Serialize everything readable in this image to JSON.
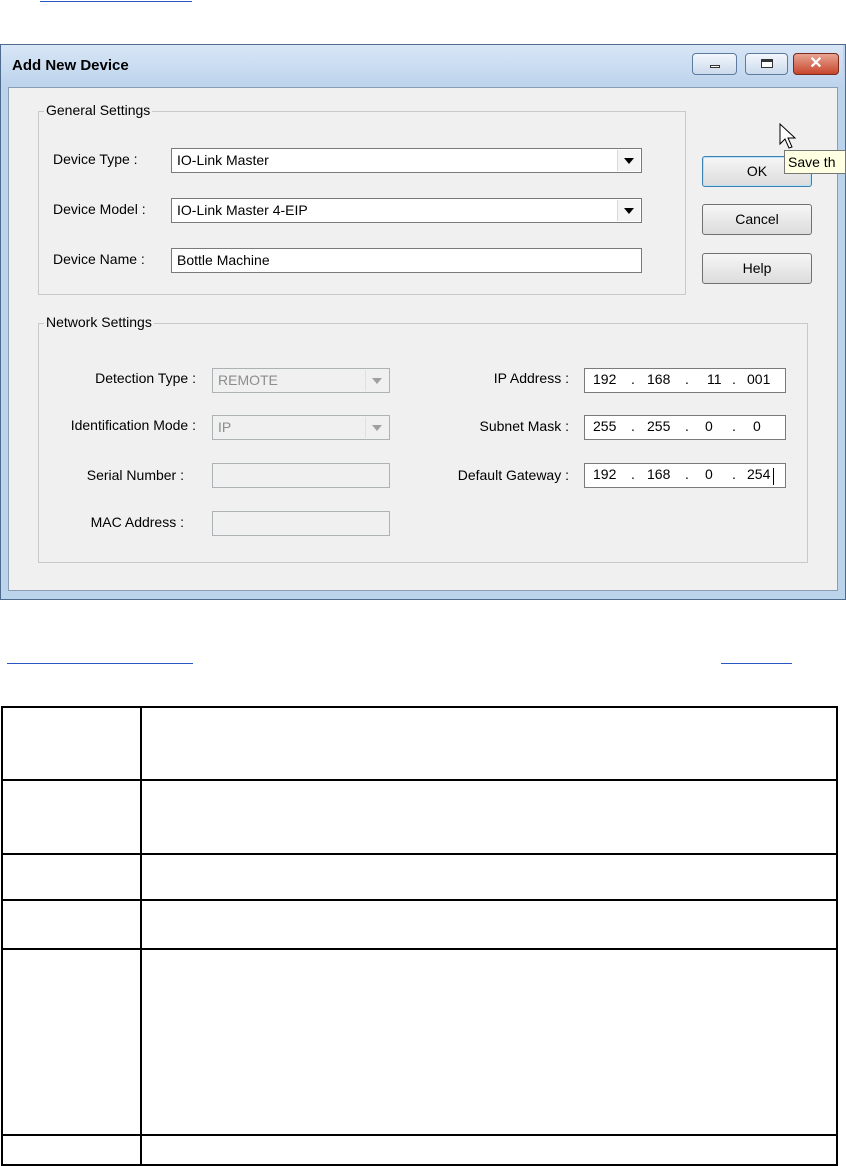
{
  "window": {
    "title": "Add New Device",
    "title_buttons": {
      "minimize": "minimize-icon",
      "maximize": "maximize-icon",
      "close": "close-icon"
    }
  },
  "general_settings": {
    "legend": "General Settings",
    "device_type_label": "Device Type :",
    "device_type_value": "IO-Link Master",
    "device_model_label": "Device Model :",
    "device_model_value": "IO-Link Master 4-EIP",
    "device_name_label": "Device Name :",
    "device_name_value": "Bottle Machine"
  },
  "network_settings": {
    "legend": "Network Settings",
    "detection_type_label": "Detection Type :",
    "detection_type_value": "REMOTE",
    "identification_mode_label": "Identification Mode :",
    "identification_mode_value": "IP",
    "serial_number_label": "Serial Number :",
    "serial_number_value": "",
    "mac_address_label": "MAC Address :",
    "mac_address_value": "",
    "ip_address_label": "IP Address :",
    "ip_address": [
      "192",
      "168",
      "11",
      "001"
    ],
    "subnet_mask_label": "Subnet Mask :",
    "subnet_mask": [
      "255",
      "255",
      "0",
      "0"
    ],
    "default_gateway_label": "Default Gateway :",
    "default_gateway": [
      "192",
      "168",
      "0",
      "254"
    ]
  },
  "buttons": {
    "ok": "OK",
    "cancel": "Cancel",
    "help": "Help"
  },
  "tooltip": "Save th",
  "colors": {
    "title_bar": "#bcd3ec",
    "dialog_bg": "#f0f0f0",
    "close_button": "#c7462b",
    "tooltip_bg": "#ffffe1",
    "link": "#2a58c7"
  }
}
